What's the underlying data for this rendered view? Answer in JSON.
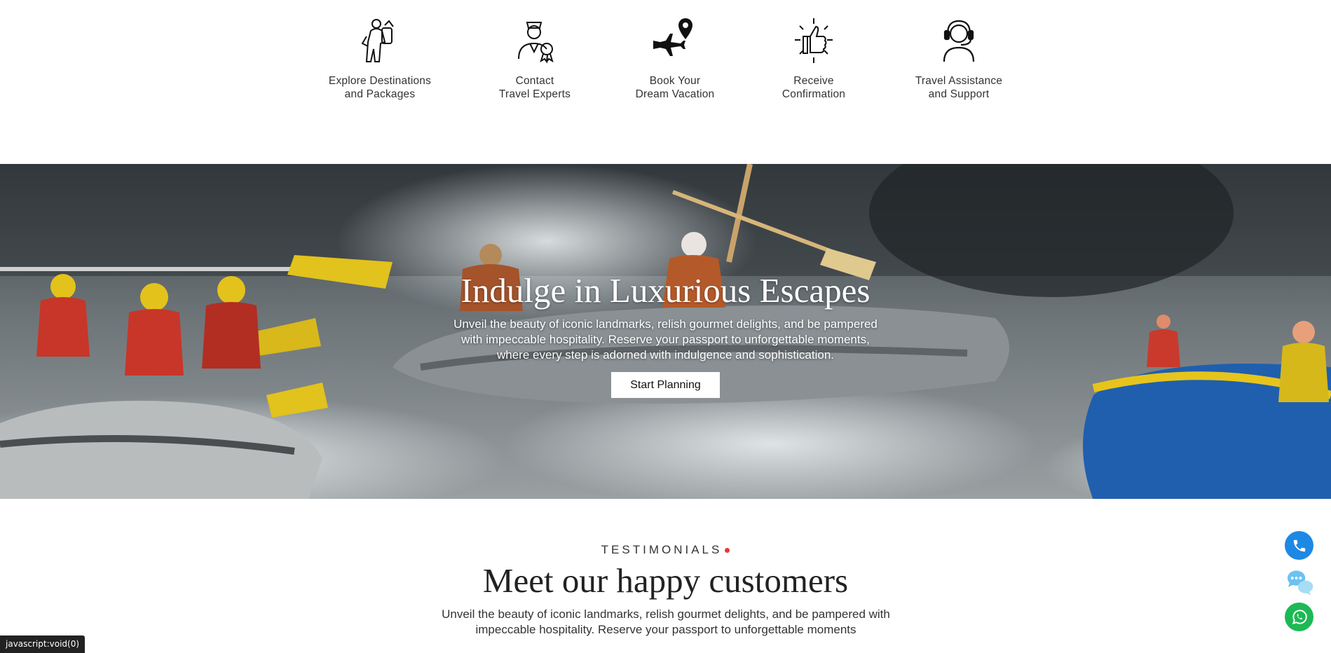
{
  "steps": [
    {
      "icon": "traveler-backpack-icon",
      "line1": "Explore Destinations",
      "line2": "and Packages"
    },
    {
      "icon": "travel-expert-icon",
      "line1": "Contact",
      "line2": "Travel Experts"
    },
    {
      "icon": "plane-location-icon",
      "line1": "Book Your",
      "line2": "Dream Vacation"
    },
    {
      "icon": "thumbs-up-icon",
      "line1": "Receive",
      "line2": "Confirmation"
    },
    {
      "icon": "support-headset-icon",
      "line1": "Travel Assistance",
      "line2": "and Support"
    }
  ],
  "hero": {
    "title": "Indulge in Luxurious Escapes",
    "text_lines": [
      "Unveil the beauty of iconic landmarks, relish gourmet delights, and be pampered",
      "with impeccable hospitality. Reserve your passport to unforgettable moments,",
      "where every step is adorned with indulgence and sophistication."
    ],
    "cta_label": "Start Planning"
  },
  "testimonials": {
    "eyebrow": "TESTIMONIALS",
    "title": "Meet our happy customers",
    "text_lines": [
      "Unveil the beauty of iconic landmarks, relish gourmet delights, and be pampered with",
      "impeccable hospitality. Reserve your passport to unforgettable moments"
    ]
  },
  "floating_actions": [
    "phone-icon",
    "chat-icon",
    "whatsapp-icon"
  ],
  "status_bar": "javascript:void(0)",
  "colors": {
    "accent_dot": "#e53935",
    "phone": "#1e88e5",
    "whatsapp": "#1db954"
  }
}
